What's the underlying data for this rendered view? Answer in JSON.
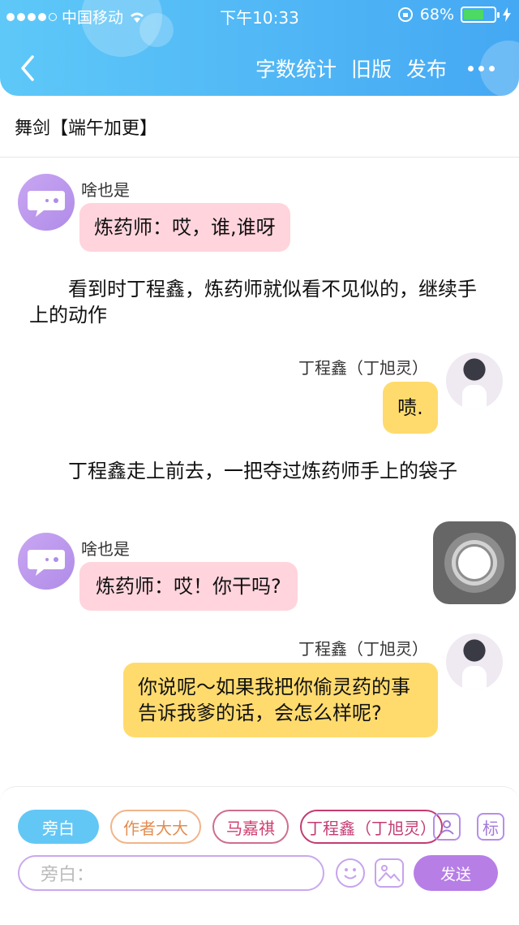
{
  "status_bar": {
    "carrier": "中国移动",
    "time": "下午10:33",
    "battery": "68%"
  },
  "nav": {
    "actions": [
      "字数统计",
      "旧版",
      "发布"
    ]
  },
  "chapter": {
    "title": "舞剑【端午加更】"
  },
  "messages": [
    {
      "type": "bubble",
      "side": "left",
      "speaker": "啥也是",
      "text": "炼药师：哎，谁,谁呀"
    },
    {
      "type": "narration",
      "text": "看到时丁程鑫，炼药师就似看不见似的，继续手上的动作"
    },
    {
      "type": "bubble",
      "side": "right",
      "speaker": "丁程鑫（丁旭灵）",
      "text": "啧."
    },
    {
      "type": "narration",
      "text": "丁程鑫走上前去，一把夺过炼药师手上的袋子"
    },
    {
      "type": "bubble",
      "side": "left",
      "speaker": "啥也是",
      "text": "炼药师：哎！你干吗?"
    },
    {
      "type": "bubble",
      "side": "right",
      "speaker": "丁程鑫（丁旭灵）",
      "text": "你说呢～如果我把你偷灵药的事告诉我爹的话，会怎么样呢?"
    }
  ],
  "role_chips": [
    "旁白",
    "作者大大",
    "马嘉祺",
    "丁程鑫（丁旭灵）"
  ],
  "mark_button": "标",
  "input": {
    "placeholder": "旁白："
  },
  "send_label": "发送",
  "colors": {
    "header": "#4fb4f5",
    "pink_bubble": "#ffd4dd",
    "yellow_bubble": "#ffdb6e",
    "send": "#b77ee6"
  }
}
